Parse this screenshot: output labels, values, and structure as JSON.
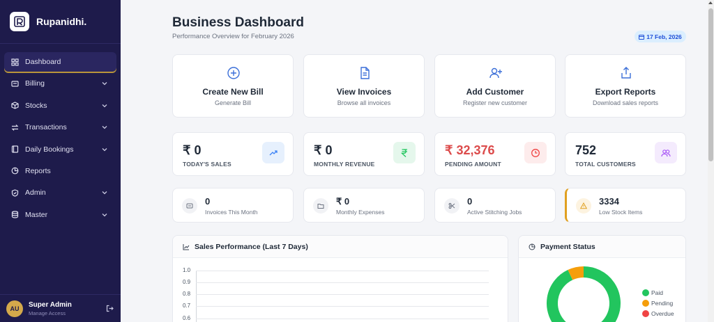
{
  "brand": {
    "name": "Rupanidhi."
  },
  "sidebar": {
    "items": [
      {
        "label": "Dashboard",
        "icon": "grid-icon",
        "active": true,
        "has_submenu": false
      },
      {
        "label": "Billing",
        "icon": "receipt-icon",
        "has_submenu": true
      },
      {
        "label": "Stocks",
        "icon": "box-icon",
        "has_submenu": true
      },
      {
        "label": "Transactions",
        "icon": "exchange-icon",
        "has_submenu": true
      },
      {
        "label": "Daily Bookings",
        "icon": "book-icon",
        "has_submenu": true
      },
      {
        "label": "Reports",
        "icon": "pie-chart-icon",
        "has_submenu": false
      },
      {
        "label": "Admin",
        "icon": "shield-icon",
        "has_submenu": true
      },
      {
        "label": "Master",
        "icon": "database-icon",
        "has_submenu": true
      }
    ],
    "user": {
      "initials": "AU",
      "name": "Super Admin",
      "role": "Manage Access"
    }
  },
  "header": {
    "title": "Business Dashboard",
    "subtitle": "Performance Overview for February 2026",
    "date": "17 Feb, 2026"
  },
  "quick_actions": [
    {
      "title": "Create New Bill",
      "subtitle": "Generate Bill",
      "icon": "plus-circle-icon"
    },
    {
      "title": "View Invoices",
      "subtitle": "Browse all invoices",
      "icon": "document-icon"
    },
    {
      "title": "Add Customer",
      "subtitle": "Register new customer",
      "icon": "user-plus-icon"
    },
    {
      "title": "Export Reports",
      "subtitle": "Download sales reports",
      "icon": "share-icon"
    }
  ],
  "stats": [
    {
      "value": "₹ 0",
      "label": "TODAY'S SALES",
      "icon": "trending-up-icon"
    },
    {
      "value": "₹ 0",
      "label": "MONTHLY REVENUE",
      "icon": "rupee-icon"
    },
    {
      "value": "₹ 32,376",
      "label": "PENDING AMOUNT",
      "icon": "clock-icon"
    },
    {
      "value": "752",
      "label": "TOTAL CUSTOMERS",
      "icon": "users-icon"
    }
  ],
  "mini_stats": [
    {
      "value": "0",
      "label": "Invoices This Month",
      "icon": "invoice-icon"
    },
    {
      "value": "₹ 0",
      "label": "Monthly Expenses",
      "icon": "folder-icon"
    },
    {
      "value": "0",
      "label": "Active Stitching Jobs",
      "icon": "scissors-icon"
    },
    {
      "value": "3334",
      "label": "Low Stock Items",
      "icon": "warning-icon"
    }
  ],
  "sales_panel": {
    "title": "Sales Performance (Last 7 Days)",
    "y_ticks": [
      "1.0",
      "0.9",
      "0.8",
      "0.7",
      "0.6"
    ]
  },
  "payment_panel": {
    "title": "Payment Status",
    "legend": [
      {
        "label": "Paid",
        "color": "#22c55e"
      },
      {
        "label": "Pending",
        "color": "#f59e0b"
      },
      {
        "label": "Overdue",
        "color": "#ef4444"
      }
    ]
  },
  "chart_data": [
    {
      "type": "line",
      "title": "Sales Performance (Last 7 Days)",
      "ylim": [
        0,
        1.0
      ],
      "y_ticks": [
        1.0,
        0.9,
        0.8,
        0.7,
        0.6
      ],
      "series": []
    },
    {
      "type": "pie",
      "title": "Payment Status",
      "categories": [
        "Paid",
        "Pending",
        "Overdue"
      ],
      "values": [
        93,
        7,
        0
      ],
      "colors": [
        "#22c55e",
        "#f59e0b",
        "#ef4444"
      ]
    }
  ]
}
